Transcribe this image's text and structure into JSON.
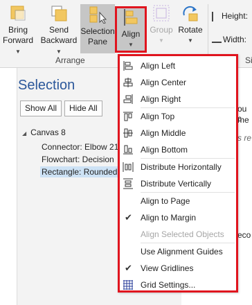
{
  "ribbon": {
    "bring_forward": {
      "line1": "Bring",
      "line2": "Forward"
    },
    "send_backward": {
      "line1": "Send",
      "line2": "Backward"
    },
    "selection_pane": {
      "line1": "Selection",
      "line2": "Pane"
    },
    "align": "Align",
    "group": "Group",
    "rotate": "Rotate",
    "height_label": "Height:",
    "width_label": "Width:",
    "arrange_group": "Arrange",
    "size_group_fragment": "Si"
  },
  "pane": {
    "title": "Selection",
    "show_all": "Show All",
    "hide_all": "Hide All",
    "tree": [
      "Canvas 8",
      "Connector: Elbow 21",
      "Flowchart: Decision",
      "Rectangle: Rounded"
    ],
    "right_fragments": [
      "ou c",
      "me",
      "s re",
      "eco"
    ]
  },
  "menu": {
    "items": [
      "Align Left",
      "Align Center",
      "Align Right",
      "Align Top",
      "Align Middle",
      "Align Bottom",
      "Distribute Horizontally",
      "Distribute Vertically",
      "Align to Page",
      "Align to Margin",
      "Align Selected Objects",
      "Use Alignment Guides",
      "View Gridlines",
      "Grid Settings..."
    ]
  },
  "colors": {
    "highlight_border": "#e0141e",
    "pane_title": "#2b579a",
    "selection_row": "#cde2f5"
  }
}
